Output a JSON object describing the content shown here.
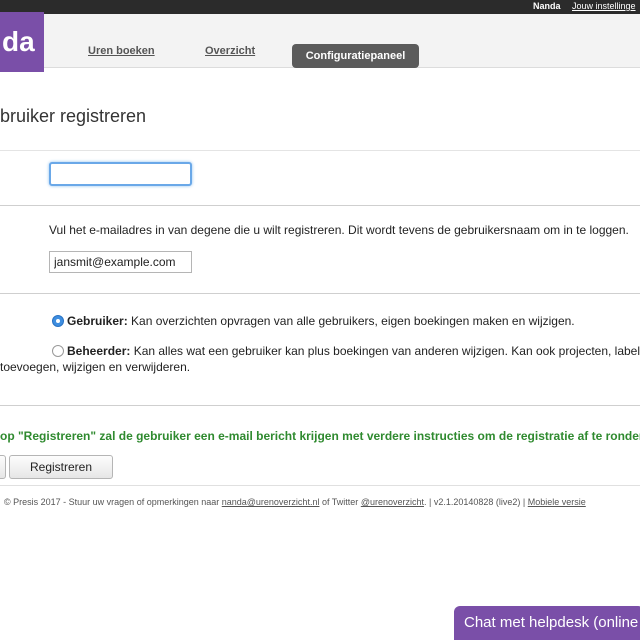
{
  "topbar": {
    "user_name": "Nanda",
    "settings_link": "Jouw instellinge"
  },
  "header": {
    "logo_text": "da",
    "nav": {
      "hours": "Uren boeken",
      "overview": "Overzicht",
      "config": "Configuratiepaneel"
    }
  },
  "form": {
    "title": "bruiker registreren",
    "name_value": "",
    "instruction": "Vul het e-mailadres in van degene die u wilt registreren. Dit wordt tevens de gebruikersnaam om in te loggen.",
    "email_value": "jansmit@example.com",
    "roles": [
      {
        "label": "Gebruiker:",
        "description": " Kan overzichten opvragen van alle gebruikers, eigen boekingen maken en wijzigen.",
        "checked": true
      },
      {
        "label": "Beheerder:",
        "description": " Kan alles wat een gebruiker kan plus boekingen van anderen wijzigen. Kan ook projecten, label",
        "continuation": "toevoegen, wijzigen en verwijderen.",
        "checked": false
      }
    ],
    "notice": "op \"Registreren\" zal de gebruiker een e-mail bericht krijgen met verdere instructies om de registratie af te ronder",
    "register_button": "Registreren"
  },
  "footer": {
    "prefix": "© Presis 2017 - Stuur uw vragen of opmerkingen naar ",
    "email": "nanda@urenoverzicht.nl",
    "middle": " of Twitter ",
    "twitter": "@urenoverzicht",
    "version_sep": ".   |  ",
    "version": "v2.1.20140828 (live2)",
    "sep2": "  |  ",
    "mobile": "Mobiele versie"
  },
  "chat": {
    "label": "Chat met helpdesk (online"
  },
  "colors": {
    "brand": "#7a4fa8",
    "notice_green": "#2f8a2f",
    "radio_blue": "#3e8ee0"
  }
}
